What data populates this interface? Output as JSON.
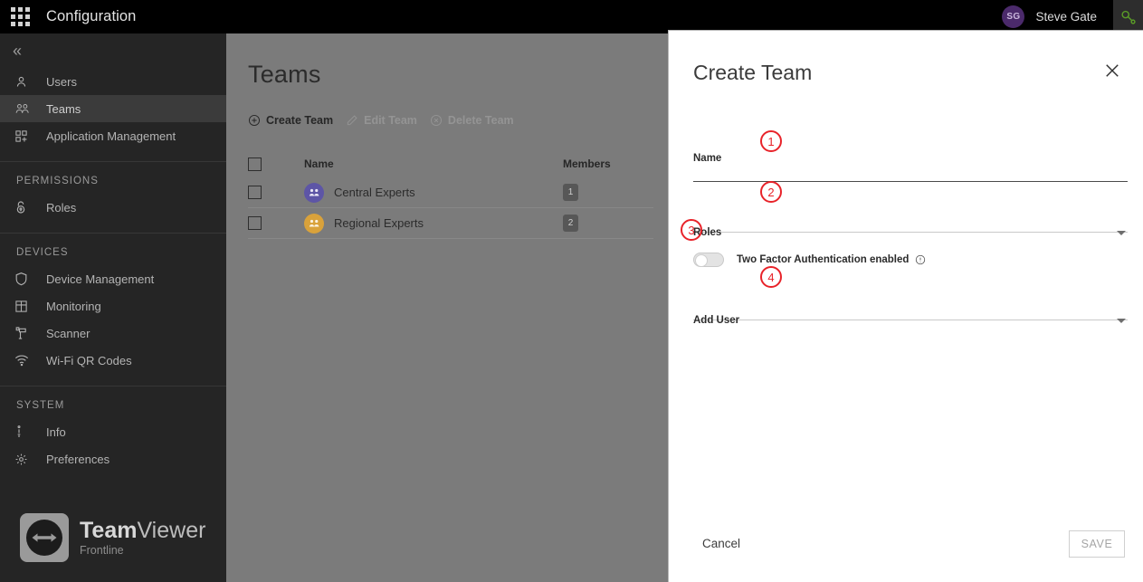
{
  "topbar": {
    "apps_icon": "grid-apps-icon",
    "title": "Configuration",
    "user": {
      "initials": "SG",
      "name": "Steve Gate",
      "avatar_color": "#4b2a6b"
    },
    "key_icon": "key-icon",
    "key_icon_color": "#5a9c27"
  },
  "sidebar": {
    "collapse_icon": "chevron-double-left-icon",
    "items": [
      {
        "label": "Users",
        "icon": "person-icon",
        "active": false
      },
      {
        "label": "Teams",
        "icon": "people-icon",
        "active": true
      },
      {
        "label": "Application Management",
        "icon": "app-add-icon",
        "active": false
      }
    ],
    "groups": [
      {
        "title": "PERMISSIONS",
        "items": [
          {
            "label": "Roles",
            "icon": "lock-icon",
            "active": false
          }
        ]
      },
      {
        "title": "DEVICES",
        "items": [
          {
            "label": "Device Management",
            "icon": "shield-icon",
            "active": false
          },
          {
            "label": "Monitoring",
            "icon": "grid-table-icon",
            "active": false
          },
          {
            "label": "Scanner",
            "icon": "scanner-icon",
            "active": false
          },
          {
            "label": "Wi-Fi QR Codes",
            "icon": "wifi-icon",
            "active": false
          }
        ]
      },
      {
        "title": "SYSTEM",
        "items": [
          {
            "label": "Info",
            "icon": "info-person-icon",
            "active": false
          },
          {
            "label": "Preferences",
            "icon": "gear-icon",
            "active": false
          }
        ]
      }
    ],
    "logo": {
      "brand_bold": "Team",
      "brand_light": "Viewer",
      "product": "Frontline",
      "mark_icon": "teamviewer-arrows-icon"
    }
  },
  "main": {
    "page_title": "Teams",
    "toolbar": [
      {
        "label": "Create Team",
        "icon": "plus-circle-icon",
        "enabled": true
      },
      {
        "label": "Edit Team",
        "icon": "pencil-icon",
        "enabled": false
      },
      {
        "label": "Delete Team",
        "icon": "x-circle-icon",
        "enabled": false
      }
    ],
    "table": {
      "select_all_checkbox": "unchecked",
      "columns": [
        "Name",
        "Members"
      ],
      "rows": [
        {
          "checked": false,
          "avatar_icon": "people-icon",
          "avatar_color": "#5d55a6",
          "name": "Central Experts",
          "members": "1"
        },
        {
          "checked": false,
          "avatar_icon": "people-icon",
          "avatar_color": "#d9a23b",
          "name": "Regional Experts",
          "members": "2"
        }
      ]
    }
  },
  "dialog": {
    "title": "Create Team",
    "close_icon": "close-icon",
    "fields": {
      "name": {
        "label": "Name",
        "value": "",
        "focused": true
      },
      "roles": {
        "label": "Roles",
        "value": "",
        "caret_icon": "chevron-down-icon"
      },
      "add_user": {
        "label": "Add User",
        "value": "",
        "caret_icon": "chevron-down-icon"
      }
    },
    "toggle": {
      "label": "Two Factor Authentication enabled",
      "state": "off",
      "info_icon": "info-circle-icon"
    },
    "cancel_label": "Cancel",
    "save_label": "SAVE",
    "save_enabled": false
  },
  "annotations": [
    {
      "number": "1",
      "target": "name-field"
    },
    {
      "number": "2",
      "target": "roles-field"
    },
    {
      "number": "3",
      "target": "two-factor-toggle"
    },
    {
      "number": "4",
      "target": "add-user-field"
    }
  ],
  "colors": {
    "annotation": "#e8232a",
    "scrim": "#7b7b7b",
    "sidebar": "#252525"
  }
}
